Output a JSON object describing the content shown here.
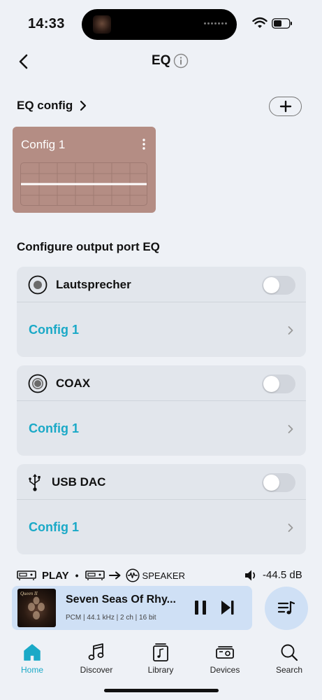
{
  "status": {
    "time": "14:33"
  },
  "header": {
    "title": "EQ"
  },
  "eq_config": {
    "title": "EQ config",
    "card_label": "Config 1",
    "card_color": "#b48d84"
  },
  "output_section": {
    "title": "Configure output port EQ",
    "ports": [
      {
        "name": "Lautsprecher",
        "config": "Config 1",
        "enabled": false,
        "icon": "speaker-port-icon"
      },
      {
        "name": "COAX",
        "config": "Config 1",
        "enabled": false,
        "icon": "coax-port-icon"
      },
      {
        "name": "USB DAC",
        "config": "Config 1",
        "enabled": false,
        "icon": "usb-icon"
      }
    ]
  },
  "playback": {
    "state": "PLAY",
    "separator": "•",
    "output": "SPEAKER",
    "volume": "-44.5 dB"
  },
  "now_playing": {
    "title": "Seven Seas Of Rhy...",
    "meta": "PCM | 44.1 kHz | 2 ch | 16 bit",
    "art_text": "Queen II"
  },
  "tabs": [
    {
      "label": "Home",
      "icon": "home-icon",
      "active": true
    },
    {
      "label": "Discover",
      "icon": "music-note-icon",
      "active": false
    },
    {
      "label": "Library",
      "icon": "library-icon",
      "active": false
    },
    {
      "label": "Devices",
      "icon": "devices-icon",
      "active": false
    },
    {
      "label": "Search",
      "icon": "search-icon",
      "active": false
    }
  ],
  "colors": {
    "accent": "#1aa9c7",
    "card_bg": "#e2e6ec",
    "player_bg": "#cfe0f5"
  }
}
